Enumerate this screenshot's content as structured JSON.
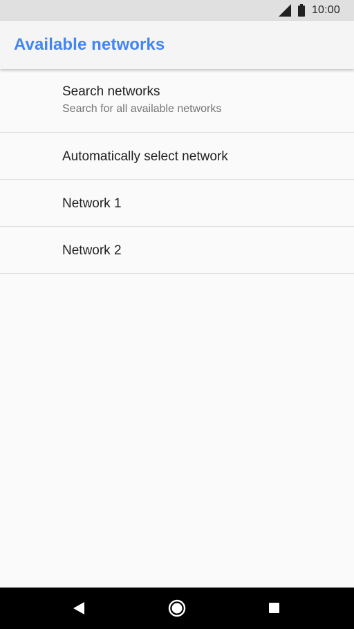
{
  "status_bar": {
    "time": "10:00",
    "icons": [
      "signal-icon",
      "battery-icon"
    ]
  },
  "app_bar": {
    "title": "Available networks",
    "title_color": "#4285f4"
  },
  "list": {
    "items": [
      {
        "title": "Search networks",
        "subtitle": "Search for all available networks"
      },
      {
        "title": "Automatically select network"
      },
      {
        "title": "Network 1"
      },
      {
        "title": "Network 2"
      }
    ]
  },
  "nav_bar": {
    "icons": [
      "back-icon",
      "home-icon",
      "recents-icon"
    ]
  }
}
